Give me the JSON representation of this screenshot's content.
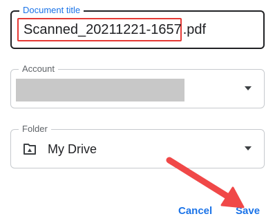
{
  "document_title": {
    "label": "Document title",
    "value_main": "Scanned_20211221-1657",
    "value_ext": ".pdf"
  },
  "account": {
    "label": "Account"
  },
  "folder": {
    "label": "Folder",
    "value": "My Drive",
    "icon": "shared-folder-icon"
  },
  "actions": {
    "cancel_label": "Cancel",
    "save_label": "Save"
  },
  "colors": {
    "accent": "#1a73e8",
    "highlight": "#e53935",
    "annotation_arrow": "#f04848"
  }
}
